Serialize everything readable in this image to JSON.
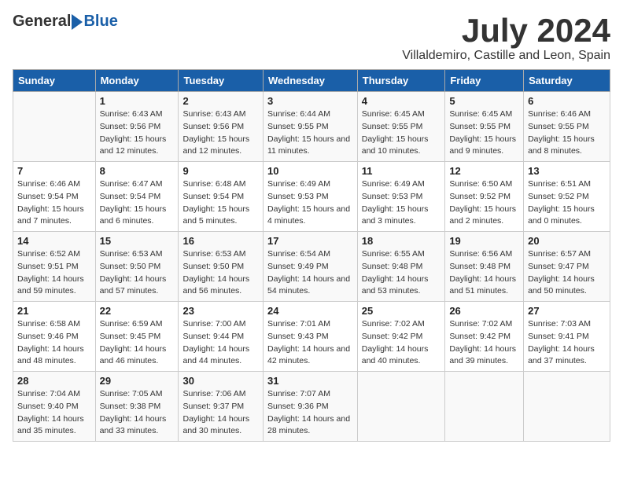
{
  "logo": {
    "general": "General",
    "blue": "Blue"
  },
  "title": "July 2024",
  "subtitle": "Villaldemiro, Castille and Leon, Spain",
  "days_of_week": [
    "Sunday",
    "Monday",
    "Tuesday",
    "Wednesday",
    "Thursday",
    "Friday",
    "Saturday"
  ],
  "weeks": [
    [
      {
        "day": "",
        "sunrise": "",
        "sunset": "",
        "daylight": ""
      },
      {
        "day": "1",
        "sunrise": "Sunrise: 6:43 AM",
        "sunset": "Sunset: 9:56 PM",
        "daylight": "Daylight: 15 hours and 12 minutes."
      },
      {
        "day": "2",
        "sunrise": "Sunrise: 6:43 AM",
        "sunset": "Sunset: 9:56 PM",
        "daylight": "Daylight: 15 hours and 12 minutes."
      },
      {
        "day": "3",
        "sunrise": "Sunrise: 6:44 AM",
        "sunset": "Sunset: 9:55 PM",
        "daylight": "Daylight: 15 hours and 11 minutes."
      },
      {
        "day": "4",
        "sunrise": "Sunrise: 6:45 AM",
        "sunset": "Sunset: 9:55 PM",
        "daylight": "Daylight: 15 hours and 10 minutes."
      },
      {
        "day": "5",
        "sunrise": "Sunrise: 6:45 AM",
        "sunset": "Sunset: 9:55 PM",
        "daylight": "Daylight: 15 hours and 9 minutes."
      },
      {
        "day": "6",
        "sunrise": "Sunrise: 6:46 AM",
        "sunset": "Sunset: 9:55 PM",
        "daylight": "Daylight: 15 hours and 8 minutes."
      }
    ],
    [
      {
        "day": "7",
        "sunrise": "Sunrise: 6:46 AM",
        "sunset": "Sunset: 9:54 PM",
        "daylight": "Daylight: 15 hours and 7 minutes."
      },
      {
        "day": "8",
        "sunrise": "Sunrise: 6:47 AM",
        "sunset": "Sunset: 9:54 PM",
        "daylight": "Daylight: 15 hours and 6 minutes."
      },
      {
        "day": "9",
        "sunrise": "Sunrise: 6:48 AM",
        "sunset": "Sunset: 9:54 PM",
        "daylight": "Daylight: 15 hours and 5 minutes."
      },
      {
        "day": "10",
        "sunrise": "Sunrise: 6:49 AM",
        "sunset": "Sunset: 9:53 PM",
        "daylight": "Daylight: 15 hours and 4 minutes."
      },
      {
        "day": "11",
        "sunrise": "Sunrise: 6:49 AM",
        "sunset": "Sunset: 9:53 PM",
        "daylight": "Daylight: 15 hours and 3 minutes."
      },
      {
        "day": "12",
        "sunrise": "Sunrise: 6:50 AM",
        "sunset": "Sunset: 9:52 PM",
        "daylight": "Daylight: 15 hours and 2 minutes."
      },
      {
        "day": "13",
        "sunrise": "Sunrise: 6:51 AM",
        "sunset": "Sunset: 9:52 PM",
        "daylight": "Daylight: 15 hours and 0 minutes."
      }
    ],
    [
      {
        "day": "14",
        "sunrise": "Sunrise: 6:52 AM",
        "sunset": "Sunset: 9:51 PM",
        "daylight": "Daylight: 14 hours and 59 minutes."
      },
      {
        "day": "15",
        "sunrise": "Sunrise: 6:53 AM",
        "sunset": "Sunset: 9:50 PM",
        "daylight": "Daylight: 14 hours and 57 minutes."
      },
      {
        "day": "16",
        "sunrise": "Sunrise: 6:53 AM",
        "sunset": "Sunset: 9:50 PM",
        "daylight": "Daylight: 14 hours and 56 minutes."
      },
      {
        "day": "17",
        "sunrise": "Sunrise: 6:54 AM",
        "sunset": "Sunset: 9:49 PM",
        "daylight": "Daylight: 14 hours and 54 minutes."
      },
      {
        "day": "18",
        "sunrise": "Sunrise: 6:55 AM",
        "sunset": "Sunset: 9:48 PM",
        "daylight": "Daylight: 14 hours and 53 minutes."
      },
      {
        "day": "19",
        "sunrise": "Sunrise: 6:56 AM",
        "sunset": "Sunset: 9:48 PM",
        "daylight": "Daylight: 14 hours and 51 minutes."
      },
      {
        "day": "20",
        "sunrise": "Sunrise: 6:57 AM",
        "sunset": "Sunset: 9:47 PM",
        "daylight": "Daylight: 14 hours and 50 minutes."
      }
    ],
    [
      {
        "day": "21",
        "sunrise": "Sunrise: 6:58 AM",
        "sunset": "Sunset: 9:46 PM",
        "daylight": "Daylight: 14 hours and 48 minutes."
      },
      {
        "day": "22",
        "sunrise": "Sunrise: 6:59 AM",
        "sunset": "Sunset: 9:45 PM",
        "daylight": "Daylight: 14 hours and 46 minutes."
      },
      {
        "day": "23",
        "sunrise": "Sunrise: 7:00 AM",
        "sunset": "Sunset: 9:44 PM",
        "daylight": "Daylight: 14 hours and 44 minutes."
      },
      {
        "day": "24",
        "sunrise": "Sunrise: 7:01 AM",
        "sunset": "Sunset: 9:43 PM",
        "daylight": "Daylight: 14 hours and 42 minutes."
      },
      {
        "day": "25",
        "sunrise": "Sunrise: 7:02 AM",
        "sunset": "Sunset: 9:42 PM",
        "daylight": "Daylight: 14 hours and 40 minutes."
      },
      {
        "day": "26",
        "sunrise": "Sunrise: 7:02 AM",
        "sunset": "Sunset: 9:42 PM",
        "daylight": "Daylight: 14 hours and 39 minutes."
      },
      {
        "day": "27",
        "sunrise": "Sunrise: 7:03 AM",
        "sunset": "Sunset: 9:41 PM",
        "daylight": "Daylight: 14 hours and 37 minutes."
      }
    ],
    [
      {
        "day": "28",
        "sunrise": "Sunrise: 7:04 AM",
        "sunset": "Sunset: 9:40 PM",
        "daylight": "Daylight: 14 hours and 35 minutes."
      },
      {
        "day": "29",
        "sunrise": "Sunrise: 7:05 AM",
        "sunset": "Sunset: 9:38 PM",
        "daylight": "Daylight: 14 hours and 33 minutes."
      },
      {
        "day": "30",
        "sunrise": "Sunrise: 7:06 AM",
        "sunset": "Sunset: 9:37 PM",
        "daylight": "Daylight: 14 hours and 30 minutes."
      },
      {
        "day": "31",
        "sunrise": "Sunrise: 7:07 AM",
        "sunset": "Sunset: 9:36 PM",
        "daylight": "Daylight: 14 hours and 28 minutes."
      },
      {
        "day": "",
        "sunrise": "",
        "sunset": "",
        "daylight": ""
      },
      {
        "day": "",
        "sunrise": "",
        "sunset": "",
        "daylight": ""
      },
      {
        "day": "",
        "sunrise": "",
        "sunset": "",
        "daylight": ""
      }
    ]
  ]
}
